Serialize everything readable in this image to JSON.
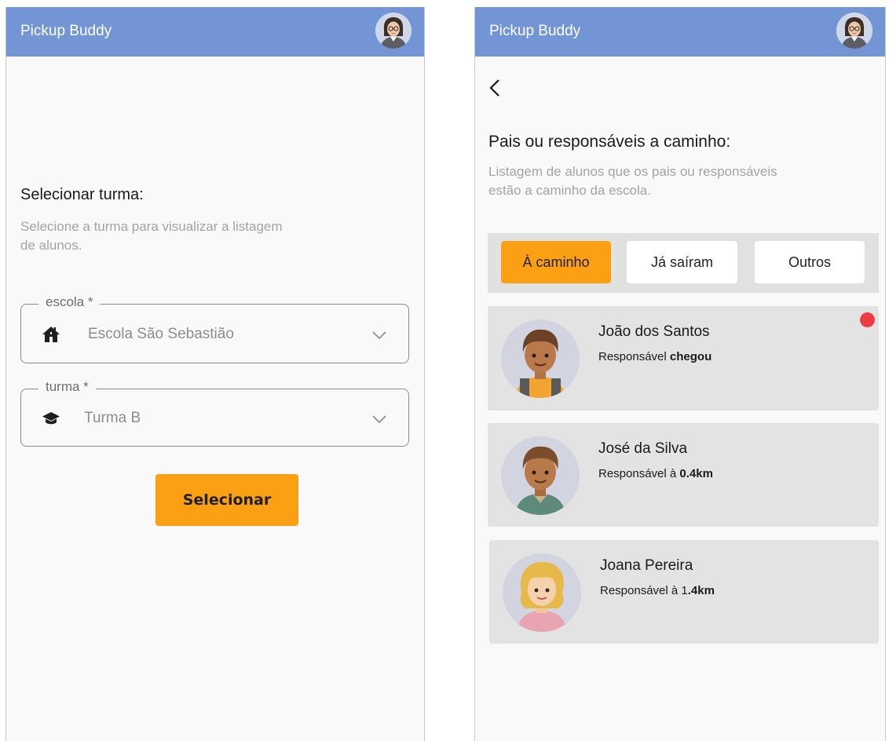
{
  "app": {
    "title": "Pickup Buddy"
  },
  "select_screen": {
    "title": "Selecionar turma:",
    "subtitle_line1": "Selecione a turma para visualizar a listagem",
    "subtitle_line2": "de alunos.",
    "school_field": {
      "label": "escola *",
      "value": "Escola São Sebastião",
      "icon": "house-icon"
    },
    "class_field": {
      "label": "turma *",
      "value": "Turma B",
      "icon": "graduation-cap-icon"
    },
    "select_button": "Selecionar"
  },
  "list_screen": {
    "title": "Pais ou responsáveis a caminho:",
    "subtitle_line1": "Listagem de alunos que os pais ou responsáveis",
    "subtitle_line2": "estão a caminho da escola.",
    "tabs": [
      {
        "label": "À caminho",
        "active": true
      },
      {
        "label": "Já saíram",
        "active": false
      },
      {
        "label": "Outros",
        "active": false
      }
    ],
    "students": [
      {
        "name": "João dos Santos",
        "status_prefix": "Responsável ",
        "status_value": "chegou",
        "notification": true
      },
      {
        "name": "José da Silva",
        "status_prefix": "Responsável à ",
        "status_value": "0.4km",
        "notification": false
      },
      {
        "name": "Joana Pereira",
        "status_prefix": "Responsável à 1",
        "status_value": ".4km",
        "notification": false
      }
    ]
  },
  "colors": {
    "appbar": "#7495d5",
    "accent": "#fba012",
    "notification": "#ee3b43",
    "card_bg": "#e3e3e3"
  }
}
